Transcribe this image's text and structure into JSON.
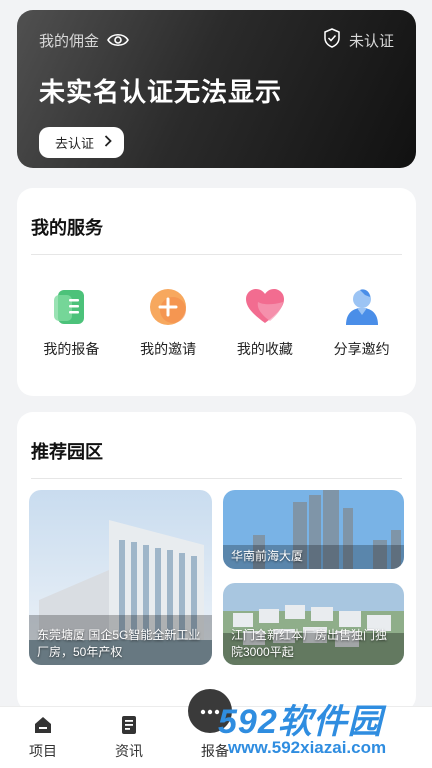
{
  "commission": {
    "label": "我的佣金",
    "status": "未认证",
    "title": "未实名认证无法显示",
    "verify_button": "去认证"
  },
  "services": {
    "title": "我的服务",
    "items": [
      {
        "label": "我的报备",
        "icon": "report-icon",
        "color": "#3fb86b"
      },
      {
        "label": "我的邀请",
        "icon": "invite-icon",
        "color": "#f6a25a"
      },
      {
        "label": "我的收藏",
        "icon": "heart-icon",
        "color": "#f06a8c"
      },
      {
        "label": "分享邀约",
        "icon": "share-user-icon",
        "color": "#4a8ee8"
      }
    ]
  },
  "parks": {
    "title": "推荐园区",
    "items": [
      {
        "caption": "东莞塘厦 国企5G智能全新工业厂房，50年产权"
      },
      {
        "caption": "华南前海大厦"
      },
      {
        "caption": "江门全新红本厂房出售独门独院3000平起"
      }
    ]
  },
  "nav": {
    "items": [
      {
        "label": "项目",
        "icon": "home-icon"
      },
      {
        "label": "资讯",
        "icon": "news-icon"
      },
      {
        "label": "报备",
        "icon": "report-nav-icon"
      }
    ]
  },
  "watermark": {
    "logo": "592软件园",
    "url": "www.592xiazai.com"
  }
}
